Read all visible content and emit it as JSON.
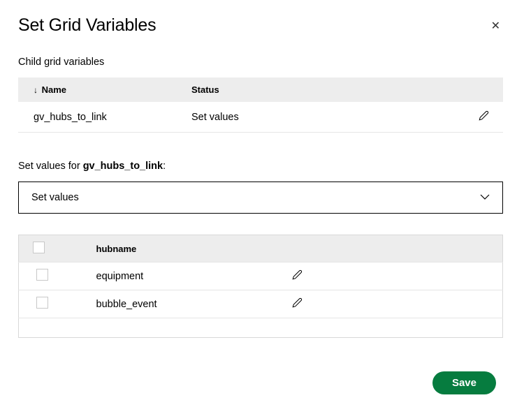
{
  "dialog": {
    "title": "Set Grid Variables",
    "close_label": "✕"
  },
  "child_section": {
    "label": "Child grid variables",
    "columns": {
      "name": "Name",
      "status": "Status"
    },
    "rows": [
      {
        "name": "gv_hubs_to_link",
        "status": "Set values"
      }
    ]
  },
  "set_values": {
    "label_prefix": "Set values for ",
    "variable": "gv_hubs_to_link",
    "label_suffix": ":",
    "dropdown_value": "Set values"
  },
  "hub_table": {
    "columns": {
      "hubname": "hubname"
    },
    "rows": [
      {
        "hubname": "equipment"
      },
      {
        "hubname": "bubble_event"
      }
    ]
  },
  "footer": {
    "save": "Save"
  }
}
